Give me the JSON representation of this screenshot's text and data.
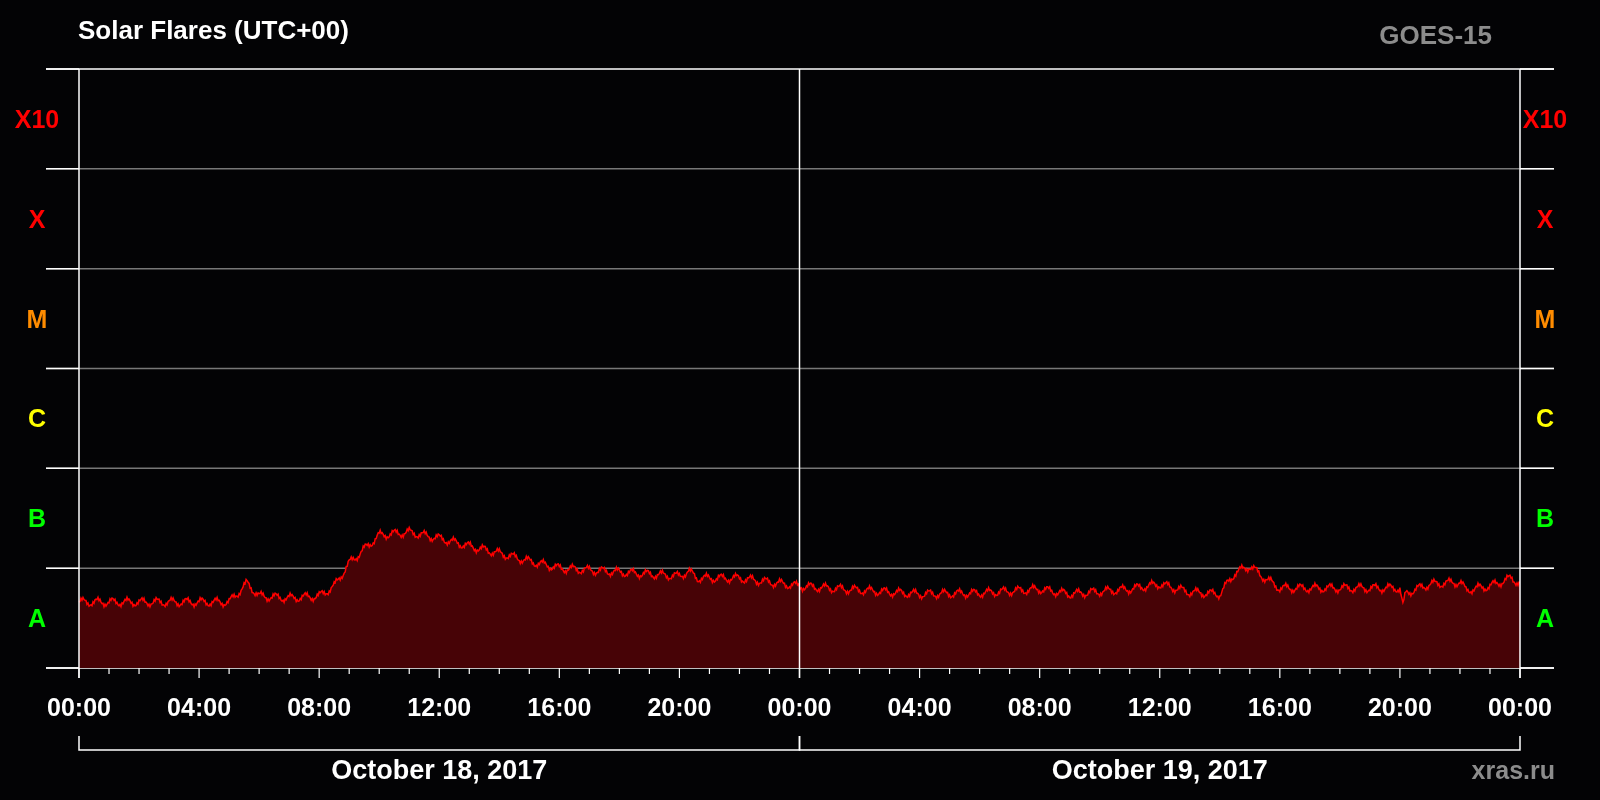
{
  "title": "Solar Flares (UTC+00)",
  "satellite": "GOES-15",
  "left_axis": [
    {
      "label": "X10",
      "color": "#ff0000"
    },
    {
      "label": "X",
      "color": "#ff0000"
    },
    {
      "label": "M",
      "color": "#ff8c00"
    },
    {
      "label": "C",
      "color": "#ffff00"
    },
    {
      "label": "B",
      "color": "#00ff00"
    },
    {
      "label": "A",
      "color": "#00ff00"
    }
  ],
  "right_axis": [
    {
      "label": "X10",
      "color": "#ff0000"
    },
    {
      "label": "X",
      "color": "#ff0000"
    },
    {
      "label": "M",
      "color": "#ff8c00"
    },
    {
      "label": "C",
      "color": "#ffff00"
    },
    {
      "label": "B",
      "color": "#00ff00"
    },
    {
      "label": "A",
      "color": "#00ff00"
    }
  ],
  "time_labels": [
    "00:00",
    "04:00",
    "08:00",
    "12:00",
    "16:00",
    "20:00",
    "00:00",
    "04:00",
    "08:00",
    "12:00",
    "16:00",
    "20:00",
    "00:00"
  ],
  "days": [
    {
      "label": "October 18, 2017"
    },
    {
      "label": "October 19, 2017"
    }
  ],
  "credit": "xras.ru"
}
